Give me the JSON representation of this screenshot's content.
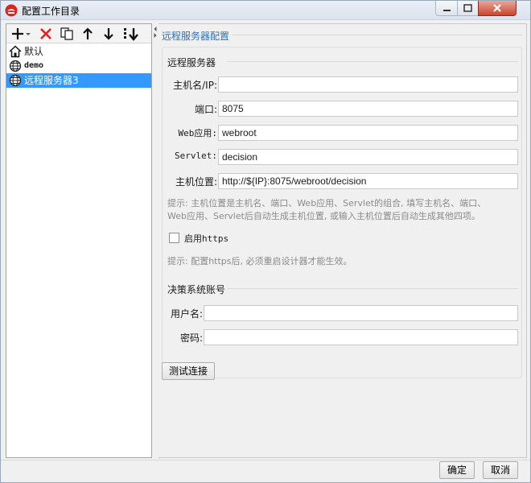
{
  "window": {
    "title": "配置工作目录"
  },
  "toolbar": {
    "buttons": [
      {
        "icon": "add-dropdown-icon"
      },
      {
        "icon": "delete-icon"
      },
      {
        "icon": "copy-icon"
      },
      {
        "icon": "move-up-icon"
      },
      {
        "icon": "move-down-icon"
      },
      {
        "icon": "sort-icon"
      }
    ]
  },
  "tree": {
    "items": [
      {
        "label": "默认",
        "icon": "home-icon",
        "selected": false
      },
      {
        "label": "demo",
        "icon": "globe-icon",
        "selected": false
      },
      {
        "label": "远程服务器3",
        "icon": "globe-icon",
        "selected": true
      }
    ]
  },
  "panel": {
    "title": "远程服务器配置",
    "server_section": "远程服务器",
    "host": {
      "label": "主机名/IP:",
      "value": ""
    },
    "port": {
      "label": "端口:",
      "value": "8075"
    },
    "webapp": {
      "label": "Web应用:",
      "value": "webroot"
    },
    "servlet": {
      "label": "Servlet:",
      "value": "decision"
    },
    "location": {
      "label": "主机位置:",
      "value": "http://${IP}:8075/webroot/decision"
    },
    "hint_line1": "提示: 主机位置是主机名、端口、Web应用、Servlet的组合, 填写主机名、端口、",
    "hint_line2": "Web应用、Servlet后自动生成主机位置, 或输入主机位置后自动生成其他四项。",
    "https_label": "启用https",
    "https_checked": false,
    "https_hint": "提示: 配置https后, 必须重启设计器才能生效。",
    "account_section": "决策系统账号",
    "username": {
      "label": "用户名:",
      "value": ""
    },
    "password": {
      "label": "密码:",
      "value": ""
    },
    "test_button": "测试连接"
  },
  "footer": {
    "ok": "确定",
    "cancel": "取消"
  },
  "colors": {
    "selection": "#3399ff",
    "title_accent": "#2f6fb7",
    "close_button": "#c9452f"
  }
}
